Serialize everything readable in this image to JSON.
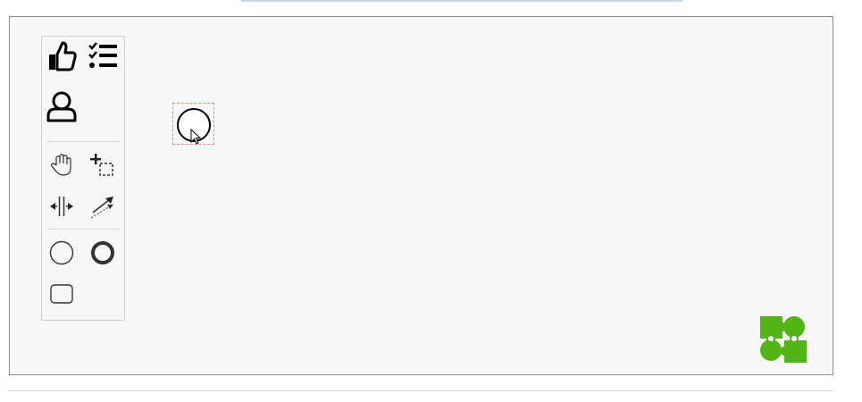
{
  "editor": {
    "palette": {
      "groups": [
        {
          "name": "custom",
          "tools": [
            "thumbs-up-tool",
            "task-list-tool",
            "user-tool"
          ]
        },
        {
          "name": "tools",
          "tools": [
            "hand-tool",
            "lasso-tool",
            "space-tool",
            "global-connect-tool"
          ]
        },
        {
          "name": "shapes",
          "tools": [
            "start-event-tool",
            "end-event-tool",
            "task-tool"
          ]
        }
      ]
    },
    "canvas": {
      "selected_element": "start-event"
    },
    "branding": {
      "logo_color": "#52b415"
    },
    "colors": {
      "selection_outline": "#f08a7e",
      "canvas_background": "#f7f7f7"
    }
  }
}
